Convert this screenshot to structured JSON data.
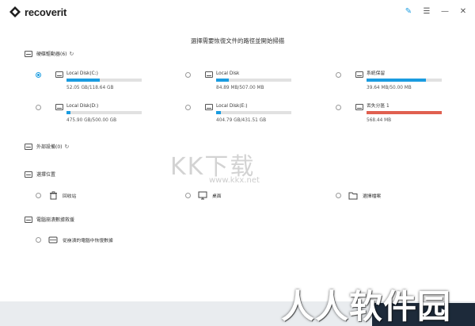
{
  "app": {
    "name": "recoverit"
  },
  "window_controls": [
    "pin-icon",
    "menu-icon",
    "minimize-icon",
    "close-icon"
  ],
  "page_title": "選擇需要恢復文件的路徑並開始掃描",
  "sections": {
    "hard_drives": {
      "label": "硬碟驅動器(6)",
      "icon": "hard-drive-icon"
    },
    "external": {
      "label": "外部設備(0)",
      "icon": "external-device-icon"
    },
    "locations": {
      "label": "選擇位置",
      "icon": "location-icon"
    },
    "crashed": {
      "label": "電腦崩潰數據救援",
      "icon": "crash-icon"
    }
  },
  "drives": [
    {
      "name": "Local Disk(C:)",
      "size": "52.05 GB/118.64 GB",
      "usage": 0.44,
      "selected": true
    },
    {
      "name": "Local Disk",
      "size": "84.89 MB/507.00 MB",
      "usage": 0.17,
      "selected": false
    },
    {
      "name": "系統保留",
      "size": "39.64 MB/50.00 MB",
      "usage": 0.79,
      "selected": false
    },
    {
      "name": "Local Disk(D:)",
      "size": "475.90 GB/500.00 GB",
      "usage": 0.05,
      "selected": false
    },
    {
      "name": "Local Disk(E:)",
      "size": "404.79 GB/431.51 GB",
      "usage": 0.06,
      "selected": false
    },
    {
      "name": "丟失分區 1",
      "size": "568.44 MB",
      "usage": 1.0,
      "selected": false
    }
  ],
  "locations": [
    {
      "label": "回收站",
      "icon": "recycle-bin-icon"
    },
    {
      "label": "桌面",
      "icon": "desktop-icon"
    },
    {
      "label": "選擇檔案",
      "icon": "folder-icon"
    }
  ],
  "crash_option": {
    "label": "從崩潰的電腦中恢復數據",
    "icon": "crashed-computer-icon"
  },
  "watermarks": {
    "top": "KK下载",
    "url": "www.kkx.net",
    "bottom": "人人软件园"
  },
  "colors": {
    "accent": "#1a9ce0",
    "lost_partition": "#e06050",
    "bar_track": "#e1e1e1"
  }
}
